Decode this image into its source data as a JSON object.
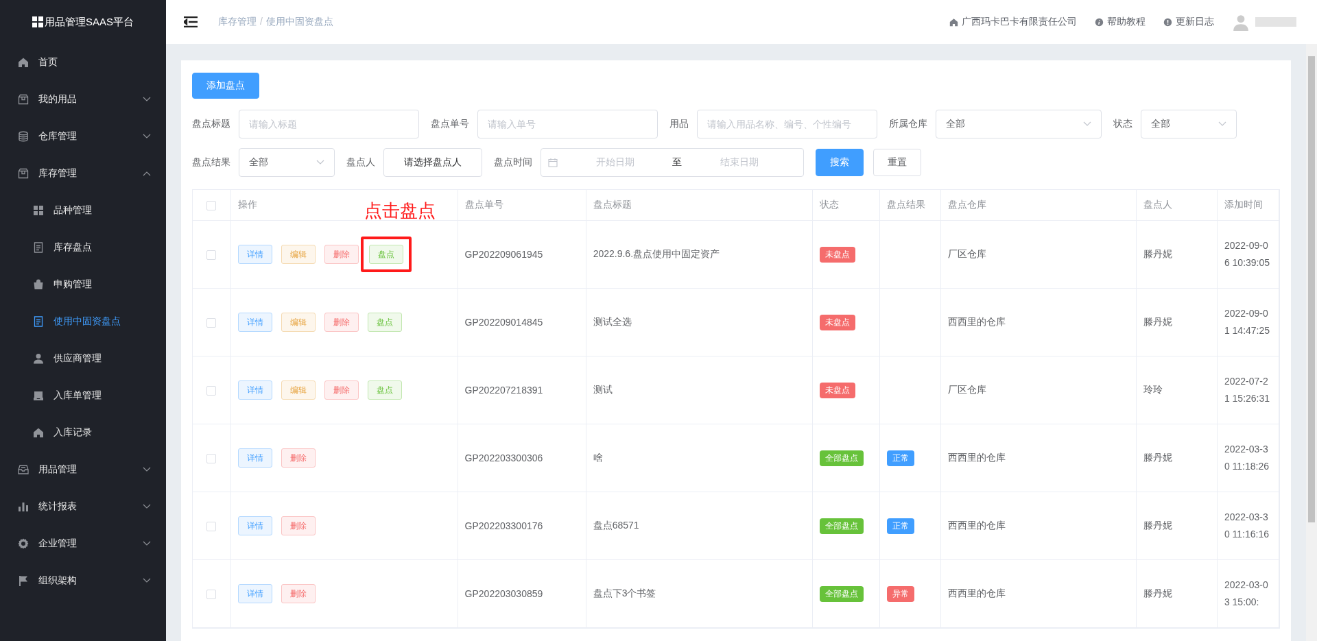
{
  "sidebar": {
    "logo": "用品管理SAAS平台",
    "items": [
      {
        "label": "首页",
        "selected": false
      },
      {
        "label": "我的用品",
        "expanded": false,
        "selected": false
      },
      {
        "label": "仓库管理",
        "expanded": false,
        "selected": false
      },
      {
        "label": "库存管理",
        "expanded": true,
        "selected": false,
        "children": [
          {
            "label": "品种管理",
            "selected": false
          },
          {
            "label": "库存盘点",
            "selected": false
          },
          {
            "label": "申购管理",
            "selected": false
          },
          {
            "label": "使用中固资盘点",
            "selected": true
          },
          {
            "label": "供应商管理",
            "selected": false
          },
          {
            "label": "入库单管理",
            "selected": false
          },
          {
            "label": "入库记录",
            "selected": false
          }
        ]
      },
      {
        "label": "用品管理",
        "expanded": false,
        "selected": false
      },
      {
        "label": "统计报表",
        "expanded": false,
        "selected": false
      },
      {
        "label": "企业管理",
        "expanded": false,
        "selected": false
      },
      {
        "label": "组织架构",
        "expanded": false,
        "selected": false
      }
    ]
  },
  "header": {
    "breadcrumb": [
      "库存管理",
      "使用中固资盘点"
    ],
    "breadcrumb_separator": "/",
    "links": [
      {
        "label": "广西玛卡巴卡有限责任公司"
      },
      {
        "label": "帮助教程"
      },
      {
        "label": "更新日志"
      }
    ]
  },
  "add_button": "添加盘点",
  "filters": [
    {
      "kind": "text",
      "label": "盘点标题",
      "placeholder": "请输入标题"
    },
    {
      "kind": "text",
      "label": "盘点单号",
      "placeholder": "请输入单号"
    },
    {
      "kind": "text",
      "label": "用品",
      "placeholder": "请输入用品名称、编号、个性编号"
    },
    {
      "kind": "select",
      "label": "所属仓库",
      "value": "全部"
    },
    {
      "kind": "select",
      "label": "状态",
      "value": "全部"
    },
    {
      "kind": "select",
      "label": "盘点结果",
      "value": "全部"
    },
    {
      "kind": "picker",
      "label": "盘点人",
      "value": "请选择盘点人"
    },
    {
      "kind": "daterange",
      "label": "盘点时间",
      "start_placeholder": "开始日期",
      "separator": "至",
      "end_placeholder": "结束日期"
    }
  ],
  "search_button": "搜索",
  "reset_button": "重置",
  "annotation": "点击盘点",
  "table": {
    "all_checked": false,
    "columns": [
      "操作",
      "盘点单号",
      "盘点标题",
      "状态",
      "盘点结果",
      "盘点仓库",
      "盘点人",
      "添加时间"
    ],
    "rows": [
      {
        "checked": false,
        "highlighted": true,
        "actions": [
          {
            "kind": "detail",
            "label": "详情"
          },
          {
            "kind": "edit",
            "label": "编辑"
          },
          {
            "kind": "delete",
            "label": "删除"
          },
          {
            "kind": "count",
            "label": "盘点"
          }
        ],
        "number": "GP202209061945",
        "title": "2022.9.6.盘点使用中固定资产",
        "status": {
          "kind": "pending",
          "label": "未盘点"
        },
        "warehouse": "厂区仓库",
        "counter": "滕丹妮",
        "time": "2022-09-06 10:39:05"
      },
      {
        "checked": false,
        "highlighted": false,
        "actions": [
          {
            "kind": "detail",
            "label": "详情"
          },
          {
            "kind": "edit",
            "label": "编辑"
          },
          {
            "kind": "delete",
            "label": "删除"
          },
          {
            "kind": "count",
            "label": "盘点"
          }
        ],
        "number": "GP202209014845",
        "title": "测试全选",
        "status": {
          "kind": "pending",
          "label": "未盘点"
        },
        "warehouse": "西西里的仓库",
        "counter": "滕丹妮",
        "time": "2022-09-01 14:47:25"
      },
      {
        "checked": false,
        "highlighted": false,
        "actions": [
          {
            "kind": "detail",
            "label": "详情"
          },
          {
            "kind": "edit",
            "label": "编辑"
          },
          {
            "kind": "delete",
            "label": "删除"
          },
          {
            "kind": "count",
            "label": "盘点"
          }
        ],
        "number": "GP202207218391",
        "title": "测试",
        "status": {
          "kind": "pending",
          "label": "未盘点"
        },
        "warehouse": "厂区仓库",
        "counter": "玲玲",
        "time": "2022-07-21 15:26:31"
      },
      {
        "checked": false,
        "highlighted": false,
        "actions": [
          {
            "kind": "detail",
            "label": "详情"
          },
          {
            "kind": "delete",
            "label": "删除"
          }
        ],
        "number": "GP202203300306",
        "title": "啥",
        "status": {
          "kind": "done",
          "label": "全部盘点"
        },
        "result": {
          "kind": "normal",
          "label": "正常"
        },
        "warehouse": "西西里的仓库",
        "counter": "滕丹妮",
        "time": "2022-03-30 11:18:26"
      },
      {
        "checked": false,
        "highlighted": false,
        "actions": [
          {
            "kind": "detail",
            "label": "详情"
          },
          {
            "kind": "delete",
            "label": "删除"
          }
        ],
        "number": "GP202203300176",
        "title": "盘点68571",
        "status": {
          "kind": "done",
          "label": "全部盘点"
        },
        "result": {
          "kind": "normal",
          "label": "正常"
        },
        "warehouse": "西西里的仓库",
        "counter": "滕丹妮",
        "time": "2022-03-30 11:16:16"
      },
      {
        "checked": false,
        "highlighted": false,
        "actions": [
          {
            "kind": "detail",
            "label": "详情"
          },
          {
            "kind": "delete",
            "label": "删除"
          }
        ],
        "number": "GP202203030859",
        "title": "盘点下3个书签",
        "status": {
          "kind": "done",
          "label": "全部盘点"
        },
        "result": {
          "kind": "abnormal",
          "label": "异常"
        },
        "warehouse": "西西里的仓库",
        "counter": "滕丹妮",
        "time": "2022-03-03 15:00:"
      }
    ]
  }
}
